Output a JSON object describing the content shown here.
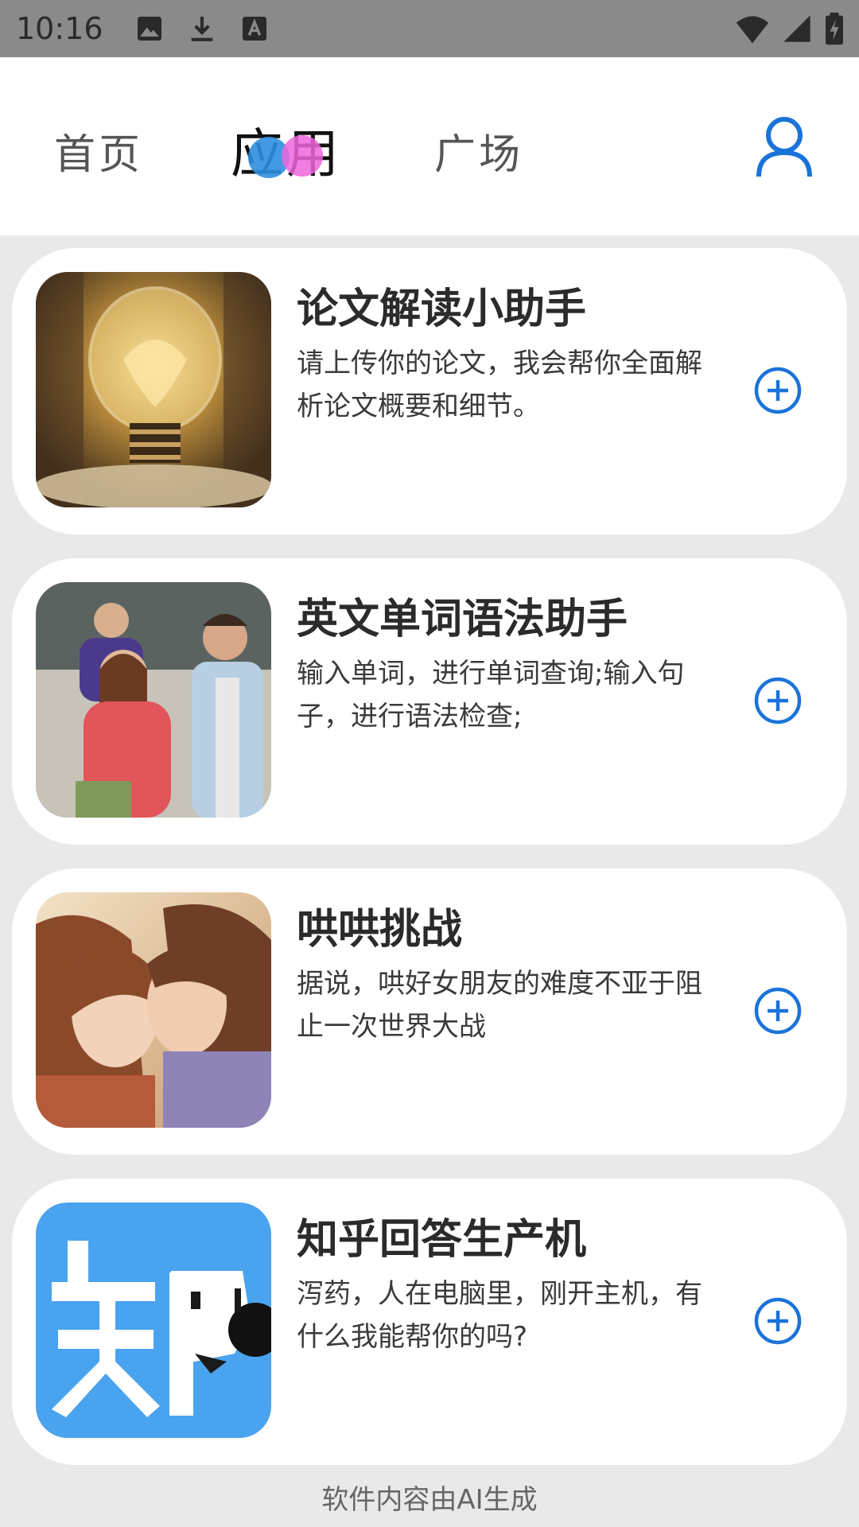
{
  "status_bar": {
    "time": "10:16",
    "icons_left": [
      "image-icon",
      "download-icon",
      "text-a-icon"
    ],
    "icons_right": [
      "wifi-icon",
      "signal-icon",
      "battery-charging-icon"
    ]
  },
  "header": {
    "tabs": [
      {
        "label": "首页",
        "active": false
      },
      {
        "label": "应用",
        "active": true
      },
      {
        "label": "广场",
        "active": false
      }
    ],
    "user_icon": "user-icon",
    "accent_color": "#1a73d9"
  },
  "cards": [
    {
      "title": "论文解读小助手",
      "description": "请上传你的论文，我会帮你全面解析论文概要和细节。",
      "image": "lightbulb-image",
      "action_icon": "add-circle-icon"
    },
    {
      "title": "英文单词语法助手",
      "description": "输入单词，进行单词查询;输入句子，进行语法检查;",
      "image": "students-classroom-image",
      "action_icon": "add-circle-icon"
    },
    {
      "title": "哄哄挑战",
      "description": "据说，哄好女朋友的难度不亚于阻止一次世界大战",
      "image": "anime-couple-image",
      "action_icon": "add-circle-icon"
    },
    {
      "title": "知乎回答生产机",
      "description": "泻药，人在电脑里，刚开主机，有什么我能帮你的吗?",
      "image": "zhihu-logo-image",
      "action_icon": "add-circle-icon"
    }
  ],
  "footer": {
    "text": "软件内容由AI生成"
  }
}
